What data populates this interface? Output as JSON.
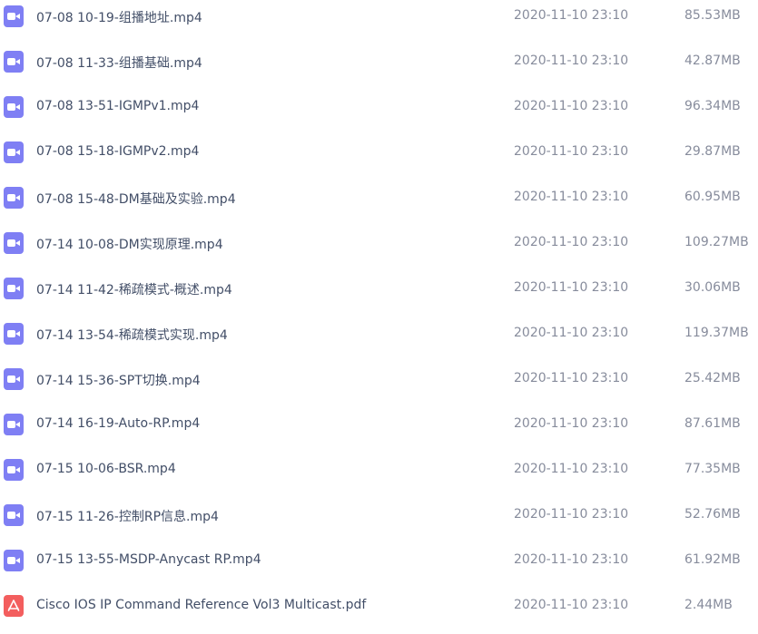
{
  "files": [
    {
      "name": "07-08 10-19-组播地址.mp4",
      "modified": "2020-11-10 23:10",
      "size": "85.53MB",
      "icon": "video-file-icon"
    },
    {
      "name": "07-08 11-33-组播基础.mp4",
      "modified": "2020-11-10 23:10",
      "size": "42.87MB",
      "icon": "video-file-icon"
    },
    {
      "name": "07-08 13-51-IGMPv1.mp4",
      "modified": "2020-11-10 23:10",
      "size": "96.34MB",
      "icon": "video-file-icon"
    },
    {
      "name": "07-08 15-18-IGMPv2.mp4",
      "modified": "2020-11-10 23:10",
      "size": "29.87MB",
      "icon": "video-file-icon"
    },
    {
      "name": "07-08 15-48-DM基础及实验.mp4",
      "modified": "2020-11-10 23:10",
      "size": "60.95MB",
      "icon": "video-file-icon"
    },
    {
      "name": "07-14 10-08-DM实现原理.mp4",
      "modified": "2020-11-10 23:10",
      "size": "109.27MB",
      "icon": "video-file-icon"
    },
    {
      "name": "07-14 11-42-稀疏模式-概述.mp4",
      "modified": "2020-11-10 23:10",
      "size": "30.06MB",
      "icon": "video-file-icon"
    },
    {
      "name": "07-14 13-54-稀疏模式实现.mp4",
      "modified": "2020-11-10 23:10",
      "size": "119.37MB",
      "icon": "video-file-icon"
    },
    {
      "name": "07-14 15-36-SPT切换.mp4",
      "modified": "2020-11-10 23:10",
      "size": "25.42MB",
      "icon": "video-file-icon"
    },
    {
      "name": "07-14 16-19-Auto-RP.mp4",
      "modified": "2020-11-10 23:10",
      "size": "87.61MB",
      "icon": "video-file-icon"
    },
    {
      "name": "07-15 10-06-BSR.mp4",
      "modified": "2020-11-10 23:10",
      "size": "77.35MB",
      "icon": "video-file-icon"
    },
    {
      "name": "07-15 11-26-控制RP信息.mp4",
      "modified": "2020-11-10 23:10",
      "size": "52.76MB",
      "icon": "video-file-icon"
    },
    {
      "name": "07-15 13-55-MSDP-Anycast RP.mp4",
      "modified": "2020-11-10 23:10",
      "size": "61.92MB",
      "icon": "video-file-icon"
    },
    {
      "name": "Cisco IOS  IP Command Reference Vol3 Multicast.pdf",
      "modified": "2020-11-10 23:10",
      "size": "2.44MB",
      "icon": "pdf-file-icon"
    }
  ],
  "colors": {
    "video_icon": "#7f7ff4",
    "pdf_icon": "#f35e5e",
    "name_text": "#424e67",
    "meta_text": "#878c9c"
  }
}
